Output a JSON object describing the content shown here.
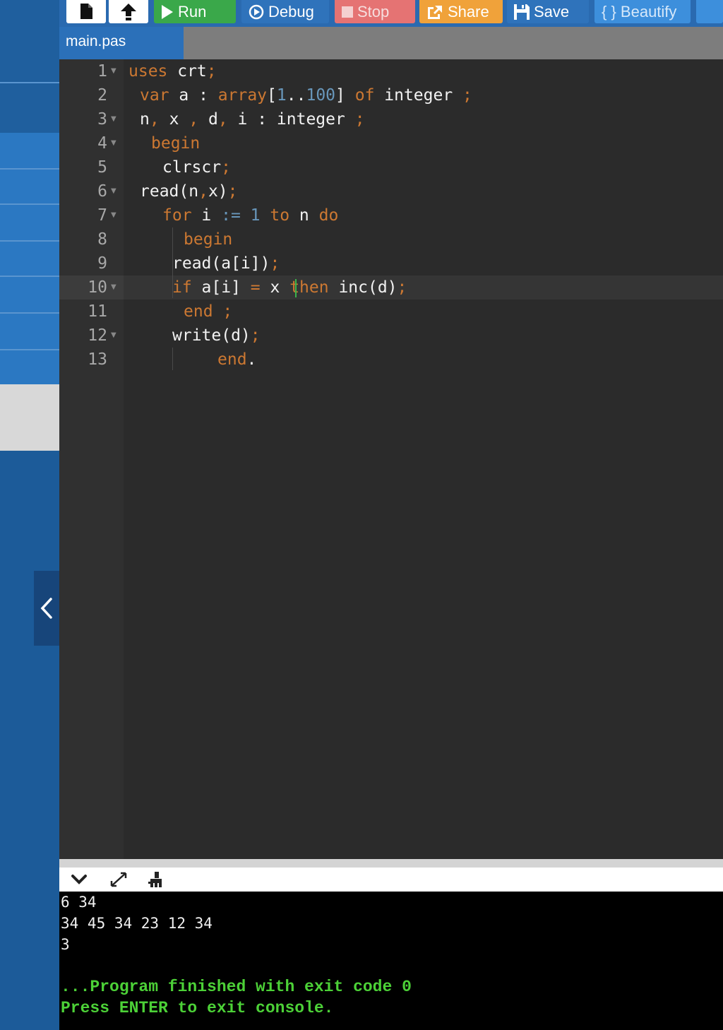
{
  "toolbar": {
    "buttons": [
      {
        "label": "Run",
        "icon": "play-icon",
        "color": "#3aa84a"
      },
      {
        "label": "Debug",
        "icon": "debug-icon",
        "color": "#2f73bb"
      },
      {
        "label": "Stop",
        "icon": "stop-icon",
        "color": "#e57373"
      },
      {
        "label": "Share",
        "icon": "share-icon",
        "color": "#f0a23a"
      },
      {
        "label": "Save",
        "icon": "save-icon",
        "color": "#2f73bb"
      },
      {
        "label": "{ } Beautify",
        "icon": "beautify-icon",
        "color": "#3d8fdc"
      }
    ],
    "icons": [
      "new-file-icon",
      "upload-icon"
    ]
  },
  "tab": {
    "filename": "main.pas"
  },
  "editor": {
    "active_line": 10,
    "lines": [
      {
        "n": "1"
      },
      {
        "n": "2"
      },
      {
        "n": "3"
      },
      {
        "n": "4"
      },
      {
        "n": "5"
      },
      {
        "n": "6"
      },
      {
        "n": "7"
      },
      {
        "n": "8"
      },
      {
        "n": "9"
      },
      {
        "n": "10"
      },
      {
        "n": "11"
      },
      {
        "n": "12"
      },
      {
        "n": "13"
      }
    ],
    "code": {
      "l1": {
        "a": "uses",
        "b": " crt",
        "c": ";"
      },
      "l2": {
        "a": "var",
        "b": " a : ",
        "c": "array",
        "d": "[",
        "e": "1",
        "f": "..",
        "g": "100",
        "h": "] ",
        "i": "of",
        "j": " integer ",
        "k": ";"
      },
      "l3": {
        "a": "n",
        "b": ",",
        "c": " x ",
        "d": ",",
        "e": " d",
        "f": ",",
        "g": " i : integer ",
        "h": ";"
      },
      "l4": {
        "a": "begin"
      },
      "l5": {
        "a": "clrscr",
        "b": ";"
      },
      "l6": {
        "a": "read(n",
        "b": ",",
        "c": "x)",
        "d": ";"
      },
      "l7": {
        "a": "for",
        "b": " i ",
        "c": ":=",
        "d": " ",
        "e": "1",
        "f": " ",
        "g": "to",
        "h": " n ",
        "i": "do"
      },
      "l8": {
        "a": "begin"
      },
      "l9": {
        "a": "read(a[i])",
        "b": ";"
      },
      "l10": {
        "a": "if",
        "b": " a[i] ",
        "c": "=",
        "d": " x ",
        "e": "then",
        "f": " inc(d)",
        "g": ";"
      },
      "l11": {
        "a": "end",
        "b": " ",
        "c": ";"
      },
      "l12": {
        "a": "write(d)",
        "b": ";"
      },
      "l13": {
        "a": "end",
        "b": "."
      }
    }
  },
  "console": {
    "lines": [
      "6 34",
      "34 45 34 23 12 34",
      "3"
    ],
    "status1": "...Program finished with exit code 0",
    "status2": "Press ENTER to exit console."
  }
}
